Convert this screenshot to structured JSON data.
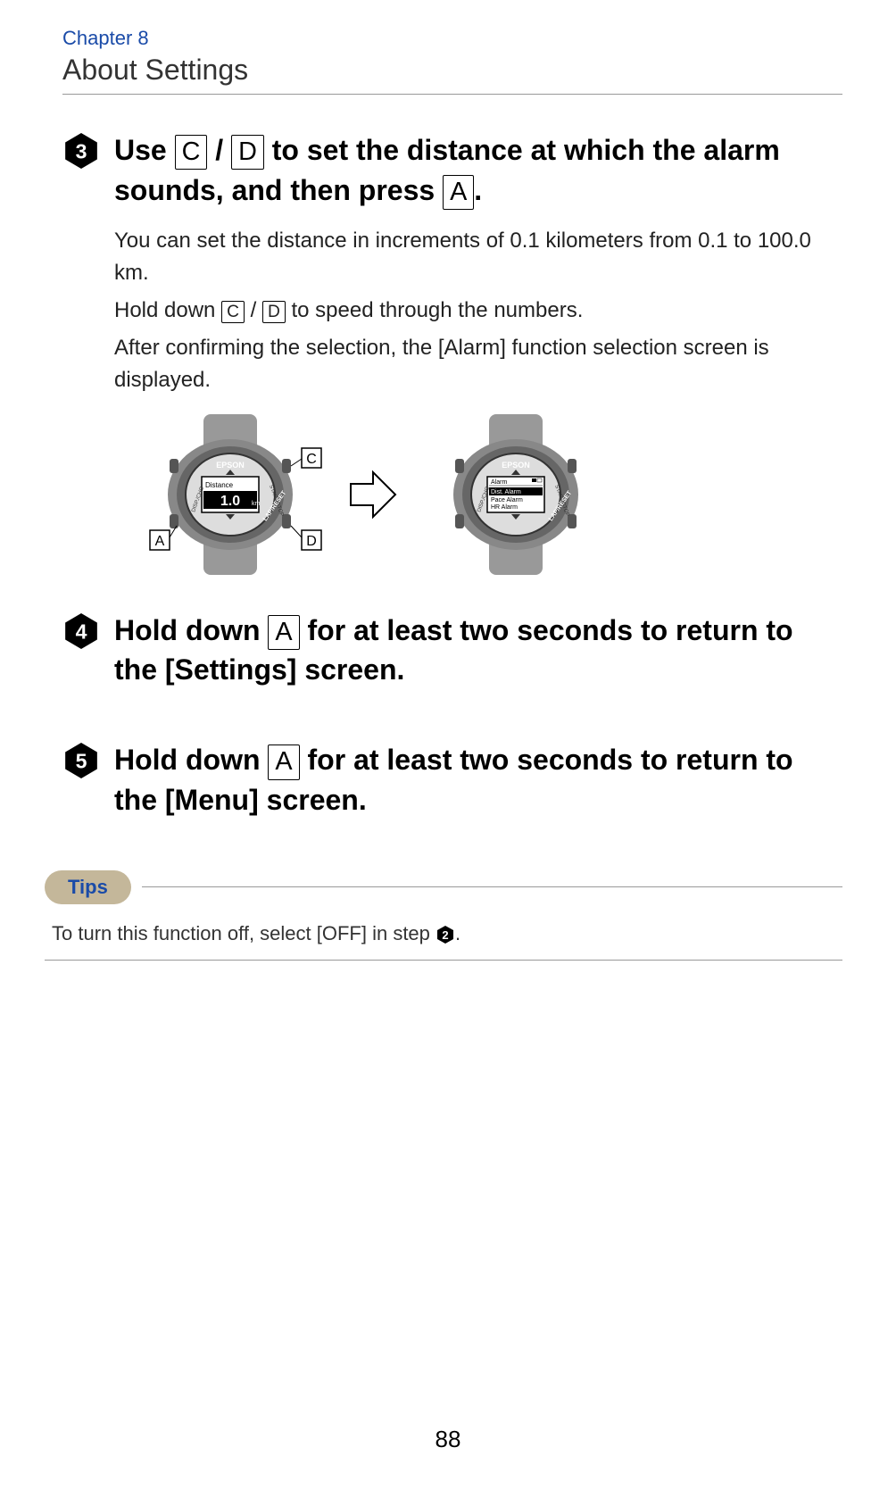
{
  "chapter": {
    "label": "Chapter 8",
    "title": "About Settings"
  },
  "steps": {
    "step3": {
      "num": "3",
      "heading_p1": "Use ",
      "heading_key1": "C",
      "heading_slash": " / ",
      "heading_key2": "D",
      "heading_p2": " to set the distance at which the alarm sounds, and then press ",
      "heading_key3": "A",
      "heading_p3": ".",
      "body_line1": "You can set the distance in increments of 0.1 kilometers from 0.1 to 100.0 km.",
      "body_line2_p1": "Hold down ",
      "body_line2_key1": "C",
      "body_line2_slash": " / ",
      "body_line2_key2": "D",
      "body_line2_p2": " to speed through the numbers.",
      "body_line3": "After confirming the selection, the [Alarm] function selection screen is displayed."
    },
    "step4": {
      "num": "4",
      "heading_p1": "Hold down ",
      "heading_key1": "A",
      "heading_p2": " for at least two seconds to return to the [Settings] screen."
    },
    "step5": {
      "num": "5",
      "heading_p1": "Hold down ",
      "heading_key1": "A",
      "heading_p2": " for at least two seconds to return to the [Menu] screen."
    }
  },
  "tips": {
    "label": "Tips",
    "body_p1": "To turn this function off, select [OFF] in step ",
    "body_step": "2",
    "body_p2": "."
  },
  "watch1": {
    "brand": "EPSON",
    "screen_label": "Distance",
    "screen_value": "1.0",
    "screen_unit": "km",
    "label_A": "A",
    "label_C": "C",
    "label_D": "D"
  },
  "watch2": {
    "brand": "EPSON",
    "screen_title": "Alarm",
    "screen_opt1": "Dist. Alarm",
    "screen_opt2": "Pace Alarm",
    "screen_opt3": "HR Alarm"
  },
  "pageNumber": "88"
}
